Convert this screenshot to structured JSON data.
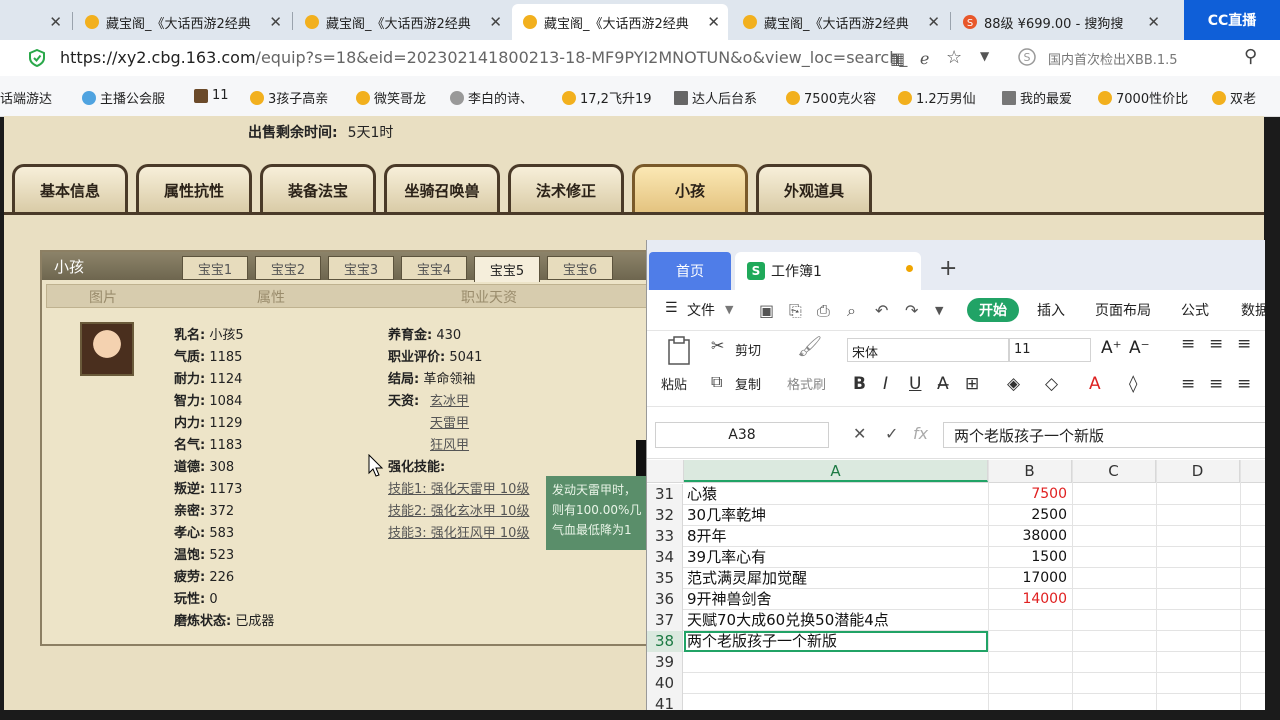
{
  "browser": {
    "tabs": [
      {
        "title": "",
        "active": false
      },
      {
        "title": "藏宝阁_《大话西游2经典",
        "active": false
      },
      {
        "title": "藏宝阁_《大话西游2经典",
        "active": false
      },
      {
        "title": "藏宝阁_《大话西游2经典",
        "active": true
      },
      {
        "title": "藏宝阁_《大话西游2经典",
        "active": false
      },
      {
        "title": "88级 ¥699.00 - 搜狗搜",
        "active": false
      }
    ],
    "tab_close": "✕",
    "cc_logo": "CC直播",
    "url_host": "https://xy2.cbg.163.com",
    "url_path": "/equip?s=18&eid=202302141800213-18-MF9PYI2MNOTUN&o&view_loc=search_",
    "address_right": "国内首次检出XBB.1.5",
    "bookmarks": [
      "话端游达",
      "主播公会服",
      "11",
      "3孩子高亲",
      "微笑哥龙",
      "李白的诗、",
      "17,2飞升19",
      "达人后台系",
      "7500克火容",
      "1.2万男仙",
      "我的最爱",
      "7000性价比",
      "双老"
    ]
  },
  "page": {
    "sale_time_label": "出售剩余时间:",
    "sale_time_value": "5天1时",
    "main_tabs": [
      "基本信息",
      "属性抗性",
      "装备法宝",
      "坐骑召唤兽",
      "法术修正",
      "小孩",
      "外观道具"
    ],
    "active_main_tab": "小孩",
    "panel_title": "小孩",
    "baby_tabs": [
      "宝宝1",
      "宝宝2",
      "宝宝3",
      "宝宝4",
      "宝宝5",
      "宝宝6"
    ],
    "column_headers": [
      "图片",
      "属性",
      "职业天资"
    ],
    "attributes": [
      {
        "k": "乳名:",
        "v": "小孩5"
      },
      {
        "k": "气质:",
        "v": "1185"
      },
      {
        "k": "耐力:",
        "v": "1124"
      },
      {
        "k": "智力:",
        "v": "1084"
      },
      {
        "k": "内力:",
        "v": "1129"
      },
      {
        "k": "名气:",
        "v": "1183"
      },
      {
        "k": "道德:",
        "v": "308"
      },
      {
        "k": "叛逆:",
        "v": "1173"
      },
      {
        "k": "亲密:",
        "v": "372"
      },
      {
        "k": "孝心:",
        "v": "583"
      },
      {
        "k": "温饱:",
        "v": "523"
      },
      {
        "k": "疲劳:",
        "v": "226"
      },
      {
        "k": "玩性:",
        "v": "0"
      },
      {
        "k": "磨炼状态:",
        "v": "已成器"
      }
    ],
    "career": [
      {
        "k": "养育金:",
        "v": "430"
      },
      {
        "k": "职业评价:",
        "v": "5041"
      },
      {
        "k": "结局:",
        "v": "革命领袖"
      }
    ],
    "talent_label": "天资:",
    "talents": [
      "玄冰甲",
      "天雷甲",
      "狂风甲"
    ],
    "skill_label": "强化技能:",
    "skills": [
      "技能1: 强化天雷甲 10级",
      "技能2: 强化玄冰甲 10级",
      "技能3: 强化狂风甲 10级"
    ],
    "tooltip_lines": [
      "发动天雷甲时，",
      "则有100.00%几",
      "气血最低降为1"
    ]
  },
  "wps": {
    "home_tab": "首页",
    "doc_tab": "工作簿1",
    "doc_icon": "S",
    "menu_file": "文件",
    "menu_start": "开始",
    "menu_items": [
      "插入",
      "页面布局",
      "公式",
      "数据"
    ],
    "ribbon": {
      "paste": "粘贴",
      "cut": "剪切",
      "copy": "复制",
      "format_painter": "格式刷",
      "font_name": "宋体",
      "font_size": "11"
    },
    "name_box": "A38",
    "formula": "两个老版孩子一个新版",
    "columns": [
      "A",
      "B",
      "C",
      "D"
    ],
    "rows": [
      {
        "n": "31",
        "a": "心猿",
        "b": "7500",
        "red": true
      },
      {
        "n": "32",
        "a": "30几率乾坤",
        "b": "2500",
        "red": false
      },
      {
        "n": "33",
        "a": "8开年",
        "b": "38000",
        "red": false
      },
      {
        "n": "34",
        "a": "39几率心有",
        "b": "1500",
        "red": false
      },
      {
        "n": "35",
        "a": "范式满灵犀加觉醒",
        "b": "17000",
        "red": false
      },
      {
        "n": "36",
        "a": "9开神兽剑舍",
        "b": "14000",
        "red": true
      },
      {
        "n": "37",
        "a": "天赋70大成60兑换50潜能4点",
        "b": "",
        "red": false
      },
      {
        "n": "38",
        "a": "两个老版孩子一个新版",
        "b": "",
        "red": false
      },
      {
        "n": "39",
        "a": "",
        "b": "",
        "red": false
      },
      {
        "n": "40",
        "a": "",
        "b": "",
        "red": false
      },
      {
        "n": "41",
        "a": "",
        "b": "",
        "red": false
      }
    ]
  }
}
